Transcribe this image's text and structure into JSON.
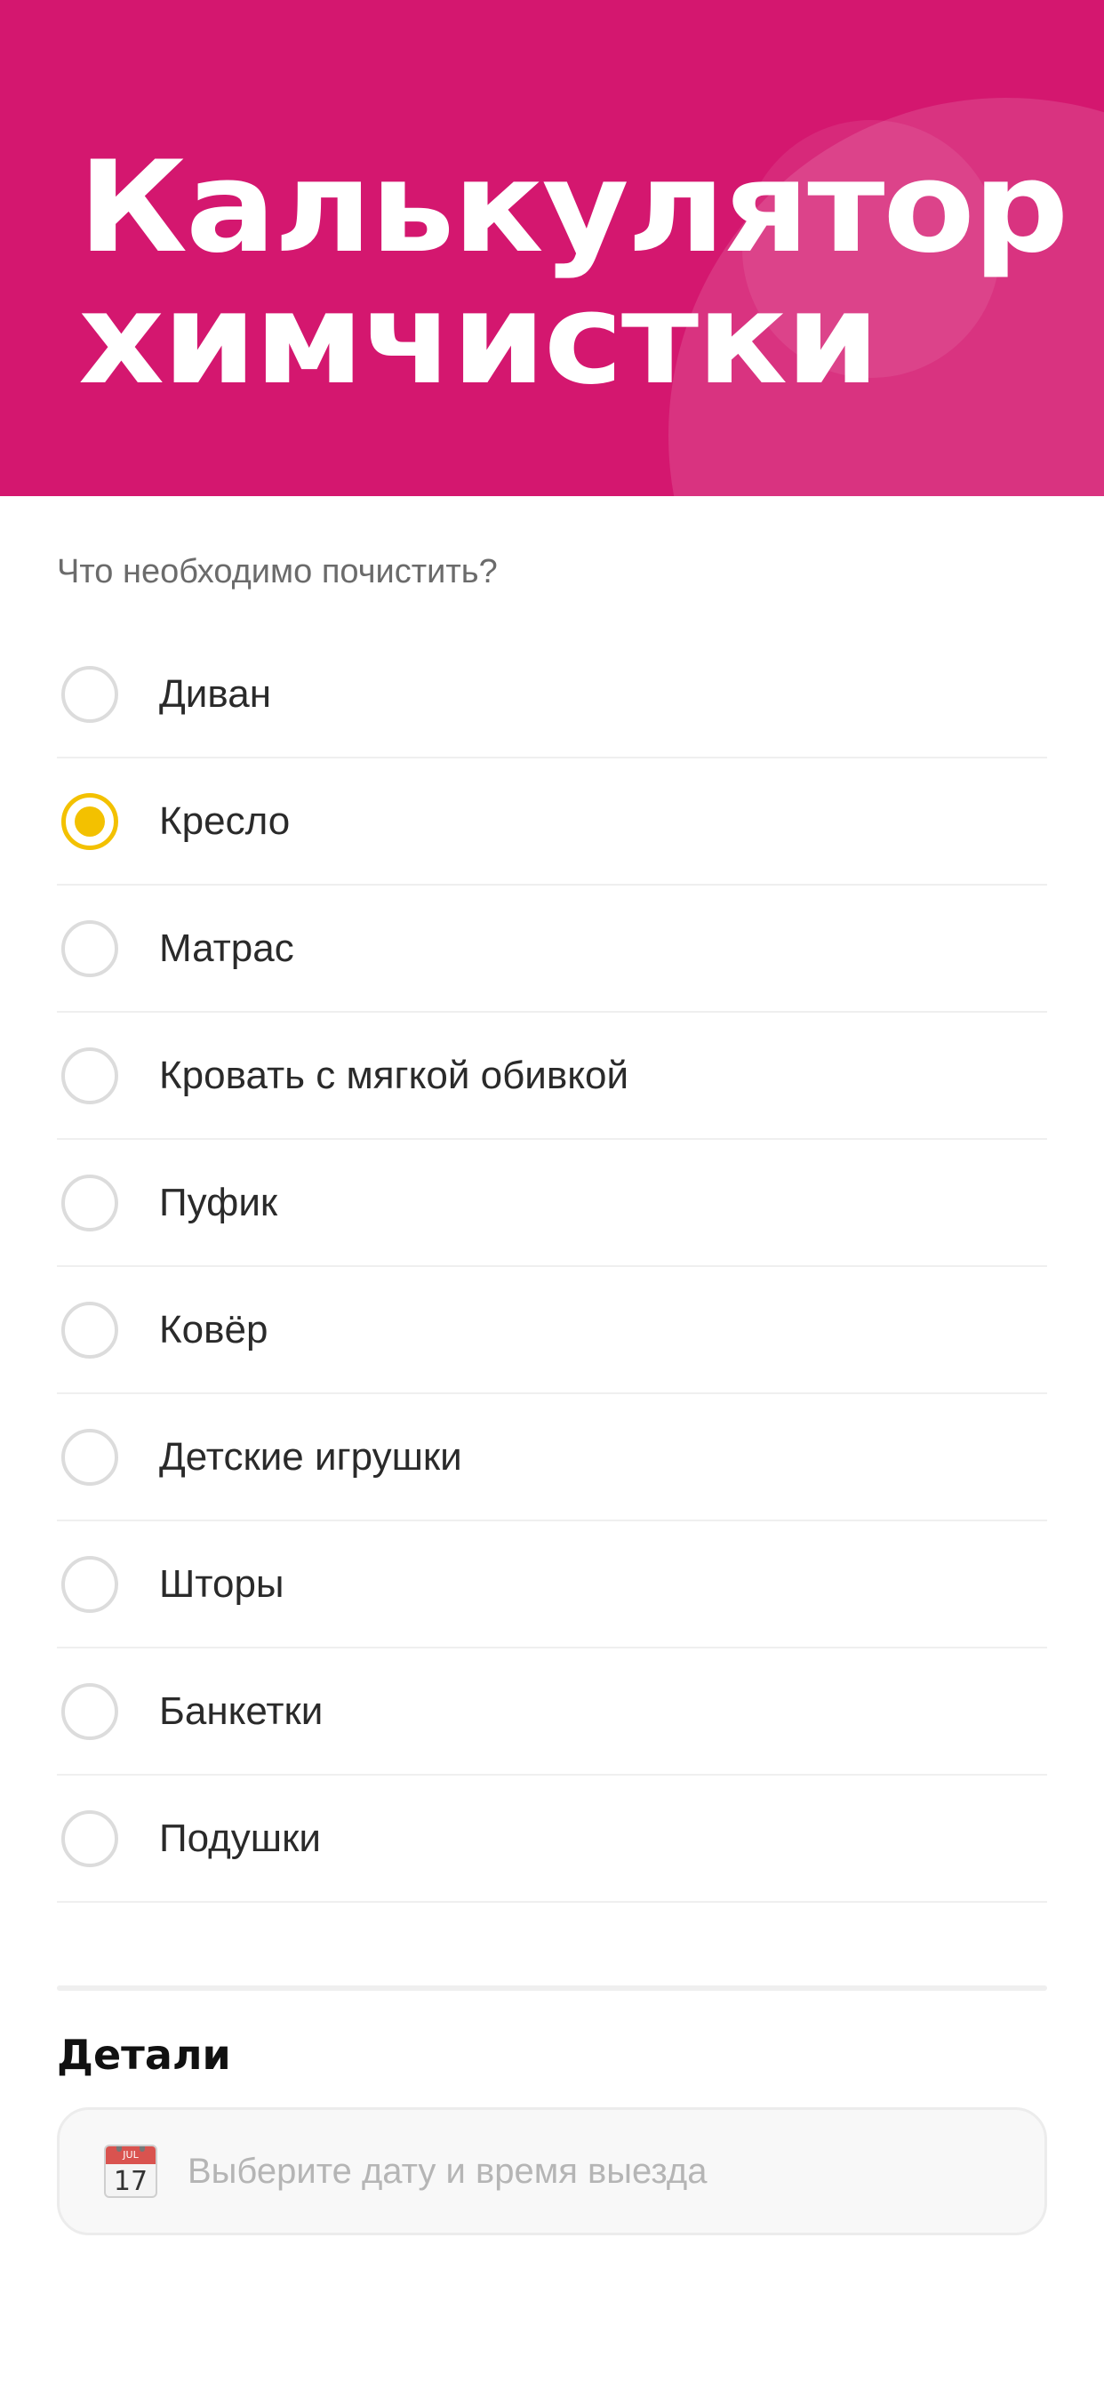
{
  "header": {
    "title_line1": "Калькулятор",
    "title_line2": "химчистки",
    "background_color": "#d4176f"
  },
  "question": "Что необходимо почистить?",
  "options": [
    {
      "label": "Диван",
      "selected": false
    },
    {
      "label": "Кресло",
      "selected": true
    },
    {
      "label": "Матрас",
      "selected": false
    },
    {
      "label": "Кровать с мягкой обивкой",
      "selected": false
    },
    {
      "label": "Пуфик",
      "selected": false
    },
    {
      "label": "Ковёр",
      "selected": false
    },
    {
      "label": "Детские игрушки",
      "selected": false
    },
    {
      "label": "Шторы",
      "selected": false
    },
    {
      "label": "Банкетки",
      "selected": false
    },
    {
      "label": "Подушки",
      "selected": false
    }
  ],
  "details": {
    "title": "Детали",
    "date_placeholder": "Выберите дату и время выезда",
    "calendar_icon": "calendar-icon",
    "calendar_month": "JUL",
    "calendar_day": "17"
  },
  "colors": {
    "accent": "#f3c100",
    "radio_border": "#dcdcdc"
  }
}
